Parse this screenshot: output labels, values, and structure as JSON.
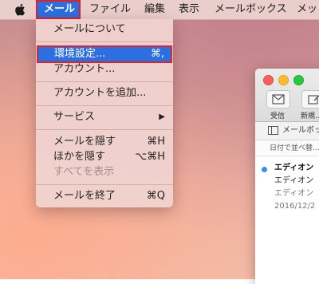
{
  "menubar": {
    "items": [
      {
        "label": "メール",
        "active": true
      },
      {
        "label": "ファイル"
      },
      {
        "label": "編集"
      },
      {
        "label": "表示"
      },
      {
        "label": "メールボックス"
      },
      {
        "label": "メッ"
      }
    ]
  },
  "mail_menu": {
    "items": [
      {
        "label": "メールについて",
        "shortcut": ""
      },
      {
        "label": "環境設定...",
        "shortcut": "⌘,",
        "highlighted": true
      },
      {
        "label": "アカウント...",
        "shortcut": ""
      },
      {
        "label": "アカウントを追加...",
        "shortcut": ""
      },
      {
        "label": "サービス",
        "shortcut": "▶"
      },
      {
        "label": "メールを隠す",
        "shortcut": "⌘H"
      },
      {
        "label": "ほかを隠す",
        "shortcut": "⌥⌘H"
      },
      {
        "label": "すべてを表示",
        "shortcut": "",
        "disabled": true
      },
      {
        "label": "メールを終了",
        "shortcut": "⌘Q"
      }
    ]
  },
  "mail_window": {
    "toolbar": {
      "receive_label": "受信",
      "new_label": "新規..."
    },
    "mailbox_label": "メールボッ",
    "sort_label": "日付で並べ替...",
    "message": {
      "sender": "エディオン",
      "subject": "エディオン",
      "preview": "エディオン",
      "date": "2016/12/2"
    }
  },
  "colors": {
    "highlight": "#2b6fe0",
    "outline_red": "#e0202a",
    "unread": "#3b8ef0"
  }
}
